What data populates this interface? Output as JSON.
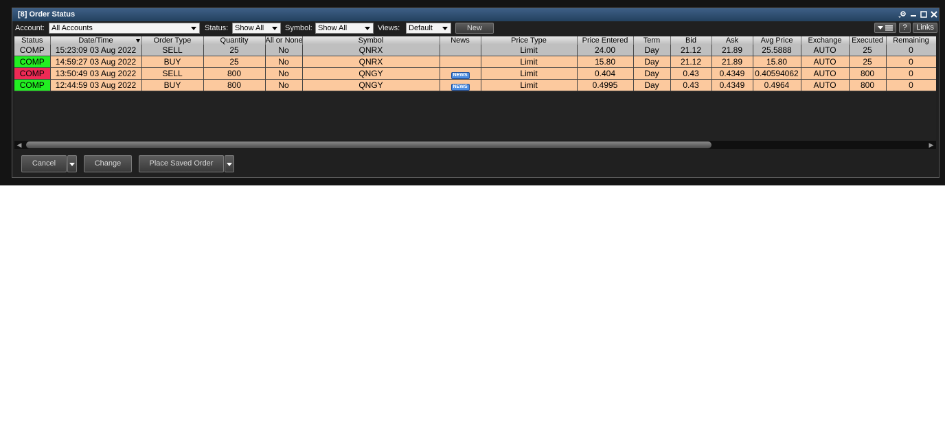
{
  "window": {
    "title": "[8] Order Status",
    "controls": [
      "settings-icon",
      "minimize-icon",
      "maximize-icon",
      "close-icon"
    ]
  },
  "toolbar": {
    "account_label": "Account:",
    "account_value": "All Accounts",
    "status_label": "Status:",
    "status_value": "Show All",
    "symbol_label": "Symbol:",
    "symbol_value": "Show All",
    "views_label": "Views:",
    "views_value": "Default",
    "new_button": "New",
    "help_button": "?",
    "links_button": "Links"
  },
  "table": {
    "columns": [
      "Status",
      "Date/Time",
      "Order Type",
      "Quantity",
      "All or None",
      "Symbol",
      "News",
      "Price Type",
      "Price Entered",
      "Term",
      "Bid",
      "Ask",
      "Avg Price",
      "Exchange",
      "Executed",
      "Remaining"
    ],
    "rows": [
      {
        "status": "COMP",
        "status_color": "gray",
        "datetime": "15:23:09 03 Aug 2022",
        "order_type": "SELL",
        "quantity": "25",
        "aon": "No",
        "symbol": "QNRX",
        "news": "",
        "price_type": "Limit",
        "price_entered": "24.00",
        "term": "Day",
        "bid": "21.12",
        "ask": "21.89",
        "avg_price": "25.5888",
        "exchange": "AUTO",
        "executed": "25",
        "remaining": "0"
      },
      {
        "status": "COMP",
        "status_color": "green",
        "datetime": "14:59:27 03 Aug 2022",
        "order_type": "BUY",
        "quantity": "25",
        "aon": "No",
        "symbol": "QNRX",
        "news": "",
        "price_type": "Limit",
        "price_entered": "15.80",
        "term": "Day",
        "bid": "21.12",
        "ask": "21.89",
        "avg_price": "15.80",
        "exchange": "AUTO",
        "executed": "25",
        "remaining": "0"
      },
      {
        "status": "COMP",
        "status_color": "red",
        "datetime": "13:50:49 03 Aug 2022",
        "order_type": "SELL",
        "quantity": "800",
        "aon": "No",
        "symbol": "QNGY",
        "news": "NEWS",
        "price_type": "Limit",
        "price_entered": "0.404",
        "term": "Day",
        "bid": "0.43",
        "ask": "0.4349",
        "avg_price": "0.40594062",
        "exchange": "AUTO",
        "executed": "800",
        "remaining": "0"
      },
      {
        "status": "COMP",
        "status_color": "green",
        "datetime": "12:44:59 03 Aug 2022",
        "order_type": "BUY",
        "quantity": "800",
        "aon": "No",
        "symbol": "QNGY",
        "news": "NEWS",
        "price_type": "Limit",
        "price_entered": "0.4995",
        "term": "Day",
        "bid": "0.43",
        "ask": "0.4349",
        "avg_price": "0.4964",
        "exchange": "AUTO",
        "executed": "800",
        "remaining": "0"
      }
    ]
  },
  "footer": {
    "cancel_button": "Cancel",
    "change_button": "Change",
    "place_saved_order_button": "Place Saved Order"
  },
  "colors": {
    "title_bar": "#2f5078",
    "row_highlight": "#fcc99e",
    "row_selected": "#bfbfbf",
    "status_green": "#22ee22",
    "status_red": "#ee2a55",
    "news_badge": "#4c8ce0"
  }
}
